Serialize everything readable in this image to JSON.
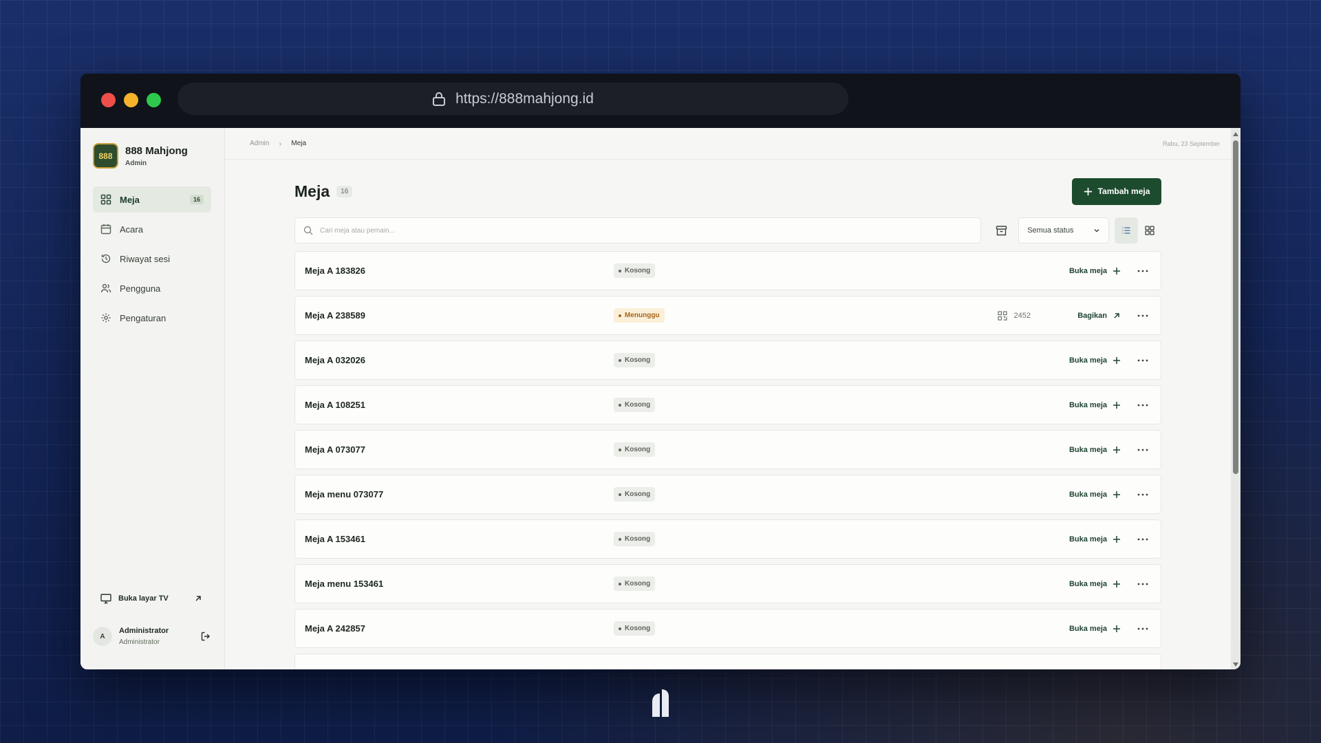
{
  "browser": {
    "url": "https://888mahjong.id"
  },
  "brand": {
    "name": "888 Mahjong",
    "role": "Admin",
    "logo_text": "888"
  },
  "sidebar": {
    "items": [
      {
        "label": "Meja",
        "badge": "16",
        "icon": "grid-icon",
        "active": true
      },
      {
        "label": "Acara",
        "icon": "calendar-icon"
      },
      {
        "label": "Riwayat sesi",
        "icon": "history-icon"
      },
      {
        "label": "Pengguna",
        "icon": "users-icon"
      },
      {
        "label": "Pengaturan",
        "icon": "gear-icon"
      }
    ],
    "tv_link": "Buka layar TV",
    "user": {
      "initial": "A",
      "name": "Administrator",
      "role": "Administrator"
    }
  },
  "topbar": {
    "crumb_root": "Admin",
    "crumb_current": "Meja",
    "date": "Rabu, 23 September"
  },
  "page": {
    "title": "Meja",
    "count": "16",
    "add_button": "Tambah meja",
    "search_placeholder": "Cari meja atau pemain...",
    "status_filter": "Semua status"
  },
  "tables": [
    {
      "name": "Meja A 183826",
      "status": "Kosong",
      "action": "Buka meja"
    },
    {
      "name": "Meja A 238589",
      "status": "Menunggu",
      "code": "2452",
      "action": "Bagikan"
    },
    {
      "name": "Meja A 032026",
      "status": "Kosong",
      "action": "Buka meja"
    },
    {
      "name": "Meja A 108251",
      "status": "Kosong",
      "action": "Buka meja"
    },
    {
      "name": "Meja A 073077",
      "status": "Kosong",
      "action": "Buka meja"
    },
    {
      "name": "Meja menu 073077",
      "status": "Kosong",
      "action": "Buka meja"
    },
    {
      "name": "Meja A 153461",
      "status": "Kosong",
      "action": "Buka meja"
    },
    {
      "name": "Meja menu 153461",
      "status": "Kosong",
      "action": "Buka meja"
    },
    {
      "name": "Meja A 242857",
      "status": "Kosong",
      "action": "Buka meja"
    }
  ],
  "colors": {
    "accent": "#1d4b2e",
    "waiting": "#a8671b",
    "idle": "#5e665c"
  }
}
